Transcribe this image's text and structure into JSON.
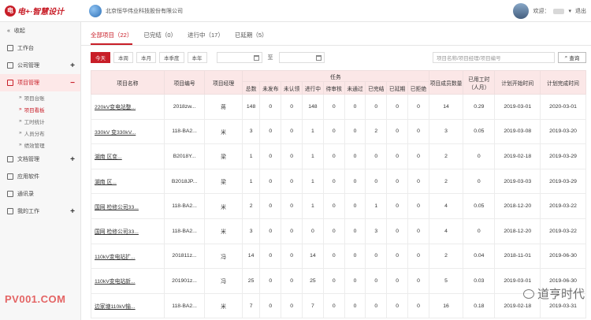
{
  "header": {
    "logo_mark": "电",
    "logo_text": "电+·智慧设计",
    "company": "北京恒华伟业科技股份有限公司",
    "welcome": "欢迎：",
    "logout": "退出"
  },
  "sidebar": {
    "collapse_label": "收起",
    "items": [
      {
        "label": "工作台"
      },
      {
        "label": "公司管理"
      },
      {
        "label": "项目管理"
      },
      {
        "label": "文档管理"
      },
      {
        "label": "应用软件"
      },
      {
        "label": "通讯录"
      },
      {
        "label": "我的工作"
      }
    ],
    "sub_items": [
      {
        "label": "项目台账"
      },
      {
        "label": "项目看板"
      },
      {
        "label": "工时统计"
      },
      {
        "label": "人员分布"
      },
      {
        "label": "绩效管理"
      }
    ]
  },
  "tabs": [
    {
      "label": "全部项目（22）"
    },
    {
      "label": "已完结（0）"
    },
    {
      "label": "进行中（17）"
    },
    {
      "label": "已延期（5）"
    }
  ],
  "filters": {
    "buttons": [
      "今天",
      "本周",
      "本月",
      "本季度",
      "本年"
    ],
    "to_label": "至",
    "search_placeholder": "项目名称/项目经理/项目编号",
    "search_button": "查询"
  },
  "table": {
    "headers": {
      "name": "项目名称",
      "code": "项目编号",
      "manager": "项目经理",
      "task_group": "任务",
      "total": "总数",
      "unpublished": "未发布",
      "unconfirmed": "未认领",
      "in_progress": "进行中",
      "pending_review": "待审核",
      "not_passed": "未通过",
      "completed": "已完结",
      "delayed": "已延期",
      "rejected": "已拒绝",
      "member_count": "项目成员数量",
      "hours_used": "已用工时（人月）",
      "plan_start": "计划开始时间",
      "plan_end": "计划完成时间"
    },
    "rows": [
      {
        "name": "220kV变电站整...",
        "code": "2018zw...",
        "manager": "蒋",
        "total": "148",
        "c1": "0",
        "c2": "0",
        "c3": "148",
        "c4": "0",
        "c5": "0",
        "c6": "0",
        "c7": "0",
        "c8": "0",
        "members": "14",
        "hours": "0.29",
        "start": "2019-03-01",
        "end": "2020-03-01"
      },
      {
        "name": "330kV 变330kV...",
        "code": "118-BA2...",
        "manager": "米",
        "total": "3",
        "c1": "0",
        "c2": "0",
        "c3": "1",
        "c4": "0",
        "c5": "0",
        "c6": "2",
        "c7": "0",
        "c8": "0",
        "members": "3",
        "hours": "0.05",
        "start": "2019-03-08",
        "end": "2019-03-20"
      },
      {
        "name": "湖南 区变...",
        "code": "B2018Y...",
        "manager": "梁",
        "total": "1",
        "c1": "0",
        "c2": "0",
        "c3": "1",
        "c4": "0",
        "c5": "0",
        "c6": "0",
        "c7": "0",
        "c8": "0",
        "members": "2",
        "hours": "0",
        "start": "2019-02-18",
        "end": "2019-03-29"
      },
      {
        "name": "湖南 区...",
        "code": "B2018JP...",
        "manager": "梁",
        "total": "1",
        "c1": "0",
        "c2": "0",
        "c3": "1",
        "c4": "0",
        "c5": "0",
        "c6": "0",
        "c7": "0",
        "c8": "0",
        "members": "2",
        "hours": "0",
        "start": "2019-03-03",
        "end": "2019-03-29"
      },
      {
        "name": "国网 检修公司33...",
        "code": "118-BA2...",
        "manager": "米",
        "total": "2",
        "c1": "0",
        "c2": "0",
        "c3": "1",
        "c4": "0",
        "c5": "0",
        "c6": "1",
        "c7": "0",
        "c8": "0",
        "members": "4",
        "hours": "0.05",
        "start": "2018-12-20",
        "end": "2019-03-22"
      },
      {
        "name": "国网 检修公司33...",
        "code": "118-BA2...",
        "manager": "米",
        "total": "3",
        "c1": "0",
        "c2": "0",
        "c3": "0",
        "c4": "0",
        "c5": "0",
        "c6": "3",
        "c7": "0",
        "c8": "0",
        "members": "4",
        "hours": "0",
        "start": "2018-12-20",
        "end": "2019-03-22"
      },
      {
        "name": "110kV变电站扩...",
        "code": "201811z...",
        "manager": "冯",
        "total": "14",
        "c1": "0",
        "c2": "0",
        "c3": "14",
        "c4": "0",
        "c5": "0",
        "c6": "0",
        "c7": "0",
        "c8": "0",
        "members": "2",
        "hours": "0.04",
        "start": "2018-11-01",
        "end": "2019-06-30"
      },
      {
        "name": "110kV变电站新...",
        "code": "201901z...",
        "manager": "冯",
        "total": "25",
        "c1": "0",
        "c2": "0",
        "c3": "25",
        "c4": "0",
        "c5": "0",
        "c6": "0",
        "c7": "0",
        "c8": "0",
        "members": "5",
        "hours": "0.03",
        "start": "2019-03-01",
        "end": "2019-06-30"
      },
      {
        "name": "边家塘110kV输...",
        "code": "118-BA2...",
        "manager": "米",
        "total": "7",
        "c1": "0",
        "c2": "0",
        "c3": "7",
        "c4": "0",
        "c5": "0",
        "c6": "0",
        "c7": "0",
        "c8": "0",
        "members": "16",
        "hours": "0.18",
        "start": "2019-02-18",
        "end": "2019-03-31"
      }
    ]
  },
  "watermarks": {
    "left": "PV001.COM",
    "right": "道亨时代"
  }
}
